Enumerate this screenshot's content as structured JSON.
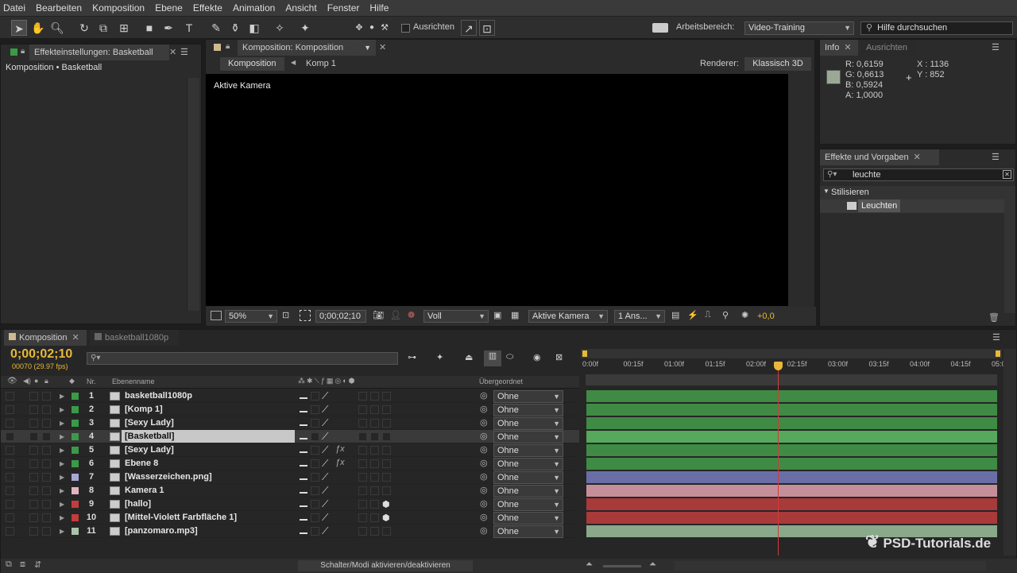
{
  "menu": [
    "Datei",
    "Bearbeiten",
    "Komposition",
    "Ebene",
    "Effekte",
    "Animation",
    "Ansicht",
    "Fenster",
    "Hilfe"
  ],
  "toolbar": {
    "align_label": "Ausrichten",
    "workspace_label": "Arbeitsbereich:",
    "workspace_value": "Video-Training",
    "search_placeholder": "Hilfe durchsuchen"
  },
  "effects_panel": {
    "tab": "Effekteinstellungen: Basketball",
    "breadcrumb": "Komposition • Basketball"
  },
  "comp_panel": {
    "tab": "Komposition: Komposition",
    "crumb_1": "Komposition",
    "crumb_2": "Komp 1",
    "renderer_label": "Renderer:",
    "renderer_value": "Klassisch 3D",
    "viewer_label": "Aktive Kamera",
    "zoom": "50%",
    "timecode": "0;00;02;10",
    "quality": "Voll",
    "view": "Aktive Kamera",
    "views": "1 Ans...",
    "exposure": "+0,0"
  },
  "info_panel": {
    "tab_info": "Info",
    "tab_align": "Ausrichten",
    "r": "R: 0,6159",
    "g": "G: 0,6613",
    "b": "B: 0,5924",
    "a": "A: 1,0000",
    "x": "X : 1136",
    "y": "Y : 852",
    "swatch": "#9ba895"
  },
  "presets_panel": {
    "tab": "Effekte und Vorgaben",
    "search_value": "leuchte",
    "category": "Stilisieren",
    "item": "Leuchten"
  },
  "timeline": {
    "tab_1": "Komposition",
    "tab_2": "basketball1080p",
    "timecode": "0;00;02;10",
    "frames": "00070 (29.97 fps)",
    "col_nr": "Nr.",
    "col_name": "Ebenenname",
    "col_parent": "Übergeordnet",
    "ruler": [
      "0:00f",
      "00:15f",
      "01:00f",
      "01:15f",
      "02:00f",
      "02:15f",
      "03:00f",
      "03:15f",
      "04:00f",
      "04:15f",
      "05:00"
    ],
    "toggle_label": "Schalter/Modi aktivieren/deaktivieren",
    "watermark": "PSD-Tutorials.de"
  },
  "layers": [
    {
      "nr": "1",
      "name": "basketball1080p",
      "label": "#3a9a48",
      "parent": "Ohne",
      "track": "#3f8a44",
      "fx": false,
      "cube": false
    },
    {
      "nr": "2",
      "name": "[Komp 1]",
      "label": "#3a9a48",
      "parent": "Ohne",
      "track": "#3f8a44",
      "fx": false,
      "cube": false
    },
    {
      "nr": "3",
      "name": "[Sexy Lady]",
      "label": "#3a9a48",
      "parent": "Ohne",
      "track": "#3f8a44",
      "fx": false,
      "cube": false
    },
    {
      "nr": "4",
      "name": "[Basketball]",
      "label": "#3a9a48",
      "parent": "Ohne",
      "track": "#55a85c",
      "fx": false,
      "cube": false,
      "selected": true
    },
    {
      "nr": "5",
      "name": "[Sexy Lady]",
      "label": "#3a9a48",
      "parent": "Ohne",
      "track": "#3f8a44",
      "fx": true,
      "cube": false
    },
    {
      "nr": "6",
      "name": "Ebene 8",
      "label": "#3a9a48",
      "parent": "Ohne",
      "track": "#3f8a44",
      "fx": true,
      "cube": false
    },
    {
      "nr": "7",
      "name": "[Wasserzeichen.png]",
      "label": "#a7a7d4",
      "parent": "Ohne",
      "track": "#6a6ea6",
      "fx": false,
      "cube": false
    },
    {
      "nr": "8",
      "name": "Kamera 1",
      "label": "#e2b4bf",
      "parent": "Ohne",
      "track": "#c48f99",
      "fx": false,
      "cube": false
    },
    {
      "nr": "9",
      "name": "[hallo]",
      "label": "#c43c3c",
      "parent": "Ohne",
      "track": "#a83a3a",
      "fx": false,
      "cube": true
    },
    {
      "nr": "10",
      "name": "[Mittel-Violett Farbfläche 1]",
      "label": "#c43c3c",
      "parent": "Ohne",
      "track": "#a83a3a",
      "fx": false,
      "cube": true
    },
    {
      "nr": "11",
      "name": "[panzomaro.mp3]",
      "label": "#a9c4a9",
      "parent": "Ohne",
      "track": "#8aa88a",
      "fx": false,
      "cube": false
    }
  ],
  "colors": {
    "accent": "#e8b83a",
    "playhead": "#d23c3c"
  }
}
